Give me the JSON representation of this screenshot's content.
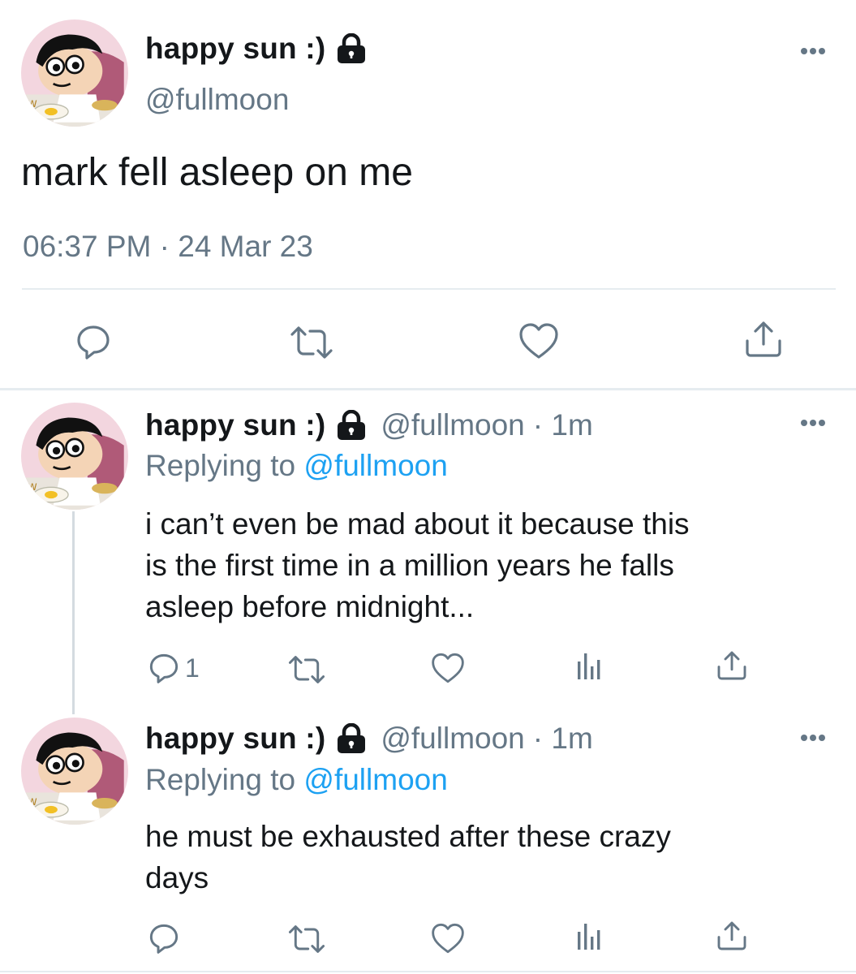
{
  "main_tweet": {
    "display_name": "happy sun :)",
    "handle": "@fullmoon",
    "text": "mark fell asleep on me",
    "timestamp": "06:37 PM · 24 Mar 23"
  },
  "replies": [
    {
      "display_name": "happy sun :)",
      "handle": "@fullmoon",
      "time": "· 1m",
      "replying_prefix": "Replying to",
      "replying_to": "@fullmoon",
      "text_lines": [
        "i can’t even be mad about it because this",
        "is the first time in a million years he falls",
        "asleep before midnight..."
      ],
      "reply_count": "1"
    },
    {
      "display_name": "happy sun :)",
      "handle": "@fullmoon",
      "time": "· 1m",
      "replying_prefix": "Replying to",
      "replying_to": "@fullmoon",
      "text_lines": [
        "he must be exhausted after these crazy",
        "days"
      ],
      "reply_count": ""
    }
  ],
  "icons": {
    "lock": "lock-icon",
    "more": "more-icon",
    "reply": "reply-icon",
    "retweet": "retweet-icon",
    "like": "heart-icon",
    "share": "share-icon",
    "analytics": "analytics-icon"
  },
  "colors": {
    "text": "#14171a",
    "secondary": "#657786",
    "link": "#1da1f2",
    "divider": "#e6ecf0"
  }
}
